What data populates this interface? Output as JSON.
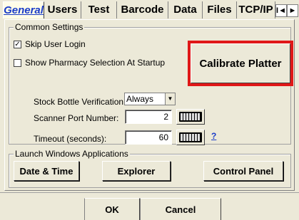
{
  "tabs": [
    {
      "label": "General",
      "active": true
    },
    {
      "label": "Users"
    },
    {
      "label": "Test"
    },
    {
      "label": "Barcode"
    },
    {
      "label": "Data"
    },
    {
      "label": "Files"
    },
    {
      "label": "TCP/IP"
    }
  ],
  "tab_scroll": {
    "left": "I◄",
    "right": "►"
  },
  "common": {
    "title": "Common Settings",
    "skip_user_login": {
      "label": "Skip User Login",
      "checked": true
    },
    "show_pharmacy": {
      "label": "Show Pharmacy Selection At Startup",
      "checked": false
    },
    "calibrate_button": "Calibrate Platter",
    "stock_bottle_label": "Stock Bottle Verification:",
    "stock_bottle_value": "Always",
    "scanner_port_label": "Scanner Port Number:",
    "scanner_port_value": "2",
    "timeout_label": "Timeout  (seconds):",
    "timeout_value": "60",
    "help": "?"
  },
  "launch": {
    "title": "Launch Windows Applications",
    "date_time": "Date & Time",
    "explorer": "Explorer",
    "control_panel": "Control Panel"
  },
  "footer": {
    "ok": "OK",
    "cancel": "Cancel"
  },
  "colors": {
    "highlight": "#e01818",
    "active_tab": "#1a3cc8"
  }
}
